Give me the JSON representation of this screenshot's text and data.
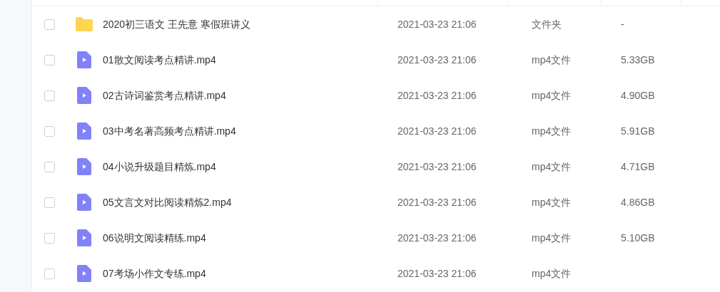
{
  "files": [
    {
      "kind": "folder",
      "name": "2020初三语文 王先意 寒假班讲义",
      "date": "2021-03-23 21:06",
      "type": "文件夹",
      "size": "-",
      "checked": false
    },
    {
      "kind": "video",
      "name": "01散文阅读考点精讲.mp4",
      "date": "2021-03-23 21:06",
      "type": "mp4文件",
      "size": "5.33GB",
      "checked": false
    },
    {
      "kind": "video",
      "name": "02古诗词鉴赏考点精讲.mp4",
      "date": "2021-03-23 21:06",
      "type": "mp4文件",
      "size": "4.90GB",
      "checked": false
    },
    {
      "kind": "video",
      "name": "03中考名著高频考点精讲.mp4",
      "date": "2021-03-23 21:06",
      "type": "mp4文件",
      "size": "5.91GB",
      "checked": false
    },
    {
      "kind": "video",
      "name": "04小说升级题目精炼.mp4",
      "date": "2021-03-23 21:06",
      "type": "mp4文件",
      "size": "4.71GB",
      "checked": false
    },
    {
      "kind": "video",
      "name": "05文言文对比阅读精炼2.mp4",
      "date": "2021-03-23 21:06",
      "type": "mp4文件",
      "size": "4.86GB",
      "checked": false
    },
    {
      "kind": "video",
      "name": "06说明文阅读精练.mp4",
      "date": "2021-03-23 21:06",
      "type": "mp4文件",
      "size": "5.10GB",
      "checked": false
    },
    {
      "kind": "video",
      "name": "07考场小作文专练.mp4",
      "date": "2021-03-23 21:06",
      "type": "mp4文件",
      "checked": false
    }
  ]
}
